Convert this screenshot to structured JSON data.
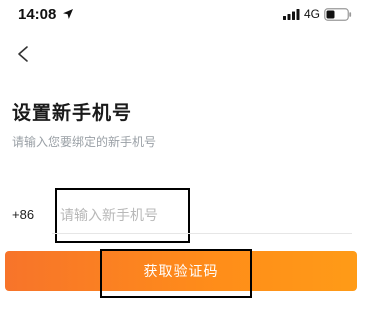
{
  "status_bar": {
    "time": "14:08",
    "network": "4G",
    "location_icon": "location-arrow-icon",
    "signal_icon": "signal-bars-icon",
    "battery_icon": "battery-icon"
  },
  "nav": {
    "back_icon": "chevron-left-icon"
  },
  "header": {
    "title": "设置新手机号",
    "subtitle": "请输入您要绑定的新手机号"
  },
  "phone": {
    "country_code": "+86",
    "placeholder": "请输入新手机号",
    "value": ""
  },
  "actions": {
    "get_code_label": "获取验证码"
  },
  "colors": {
    "accent_start": "#f7742a",
    "accent_end": "#ff9b17"
  }
}
